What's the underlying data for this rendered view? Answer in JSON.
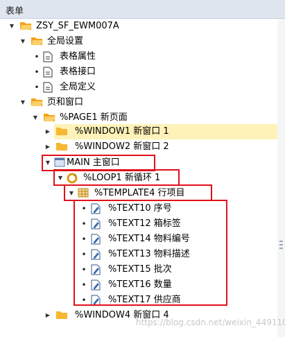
{
  "panel": {
    "title": "表单"
  },
  "tree": {
    "root": "ZSY_SF_EWM007A",
    "global_settings": "全局设置",
    "table_attributes": "表格属性",
    "table_interface": "表格接口",
    "global_definitions": "全局定义",
    "pages_windows": "页和窗口",
    "page1": "%PAGE1 新页面",
    "window1": "%WINDOW1 新窗口 1",
    "window2": "%WINDOW2 新窗口 2",
    "main": "MAIN 主窗口",
    "loop1": "%LOOP1 新循环 1",
    "template4": "%TEMPLATE4 行项目",
    "texts": [
      "%TEXT10 序号",
      "%TEXT12 箱标签",
      "%TEXT14 物料编号",
      "%TEXT13 物料描述",
      "%TEXT15 批次",
      "%TEXT16 数量",
      "%TEXT17 供应商"
    ],
    "window4": "%WINDOW4 新窗口 4"
  },
  "watermark": "https://blog.csdn.net/weixin_44911062",
  "colors": {
    "highlight": "#e0101a",
    "selection": "#fff2b8",
    "folder": "#f3a21b"
  }
}
